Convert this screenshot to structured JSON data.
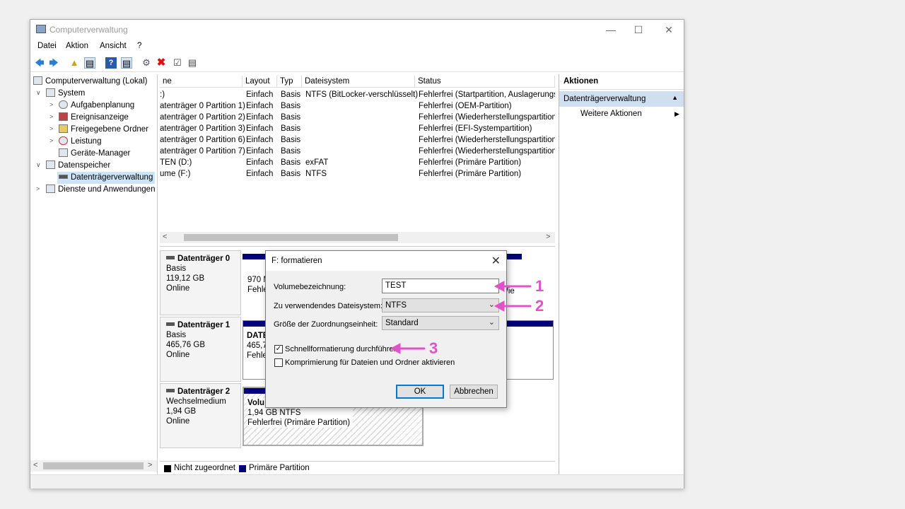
{
  "window": {
    "title": "Computerverwaltung"
  },
  "menu": [
    "Datei",
    "Aktion",
    "Ansicht",
    "?"
  ],
  "toolbar_icons": [
    "back-arrow-icon",
    "forward-arrow-icon",
    "folder-up-icon",
    "show-hide-tree-icon",
    "help-icon",
    "properties-icon",
    "connect-icon",
    "delete-icon",
    "checklist-icon",
    "view-icon"
  ],
  "tree": {
    "root": "Computerverwaltung (Lokal)",
    "system": "System",
    "aufgaben": "Aufgabenplanung",
    "ereignis": "Ereignisanzeige",
    "freigabe": "Freigegebene Ordner",
    "leistung": "Leistung",
    "geraete": "Geräte-Manager",
    "speicher": "Datenspeicher",
    "dtv": "Datenträgerverwaltung",
    "dienste": "Dienste und Anwendungen"
  },
  "volumes": {
    "headers": [
      "ne",
      "Layout",
      "Typ",
      "Dateisystem",
      "Status"
    ],
    "rows": [
      [
        ":)",
        "Einfach",
        "Basis",
        "NTFS (BitLocker-verschlüsselt)",
        "Fehlerfrei (Startpartition, Auslagerungs"
      ],
      [
        "atenträger 0 Partition 1)",
        "Einfach",
        "Basis",
        "",
        "Fehlerfrei (OEM-Partition)"
      ],
      [
        "atenträger 0 Partition 2)",
        "Einfach",
        "Basis",
        "",
        "Fehlerfrei (Wiederherstellungspartition)"
      ],
      [
        "atenträger 0 Partition 3)",
        "Einfach",
        "Basis",
        "",
        "Fehlerfrei (EFI-Systempartition)"
      ],
      [
        "atenträger 0 Partition 6)",
        "Einfach",
        "Basis",
        "",
        "Fehlerfrei (Wiederherstellungspartition)"
      ],
      [
        "atenträger 0 Partition 7)",
        "Einfach",
        "Basis",
        "",
        "Fehlerfrei (Wiederherstellungspartition)"
      ],
      [
        "TEN (D:)",
        "Einfach",
        "Basis",
        "exFAT",
        "Fehlerfrei (Primäre Partition)"
      ],
      [
        "ume (F:)",
        "Einfach",
        "Basis",
        "NTFS",
        "Fehlerfrei (Primäre Partition)"
      ]
    ]
  },
  "disks": [
    {
      "name": "Datenträger 0",
      "type": "Basis",
      "size": "119,12 GB",
      "state": "Online",
      "part_lines": [
        "970 M",
        "Fehle"
      ],
      "part_extra": "Wie"
    },
    {
      "name": "Datenträger 1",
      "type": "Basis",
      "size": "465,76 GB",
      "state": "Online",
      "part_lines": [
        "DATE",
        "465,7",
        "Fehle"
      ]
    },
    {
      "name": "Datenträger 2",
      "type": "Wechselmedium",
      "size": "1,94 GB",
      "state": "Online",
      "part_lines": [
        "Volu",
        "1,94 GB NTFS",
        "Fehlerfrei (Primäre Partition)"
      ]
    }
  ],
  "legend": {
    "unallocated": "Nicht zugeordnet",
    "primary": "Primäre Partition"
  },
  "actions": {
    "header": "Aktionen",
    "selected": "Datenträgerverwaltung",
    "more": "Weitere Aktionen"
  },
  "dialog": {
    "title": "F: formatieren",
    "label_volume": "Volumebezeichnung:",
    "value_volume": "TEST",
    "label_fs": "Zu verwendendes Dateisystem:",
    "value_fs": "NTFS",
    "label_alloc": "Größe der Zuordnungseinheit:",
    "value_alloc": "Standard",
    "quick_format": "Schnellformatierung durchführen",
    "quick_checked": true,
    "compress": "Komprimierung für Dateien und Ordner aktivieren",
    "compress_checked": false,
    "ok": "OK",
    "cancel": "Abbrechen"
  },
  "callouts": [
    "1",
    "2",
    "3"
  ],
  "colors": {
    "primary_partition": "#00007f",
    "unallocated": "#000000",
    "callout": "#e052c8",
    "selection": "#cce4f7"
  }
}
